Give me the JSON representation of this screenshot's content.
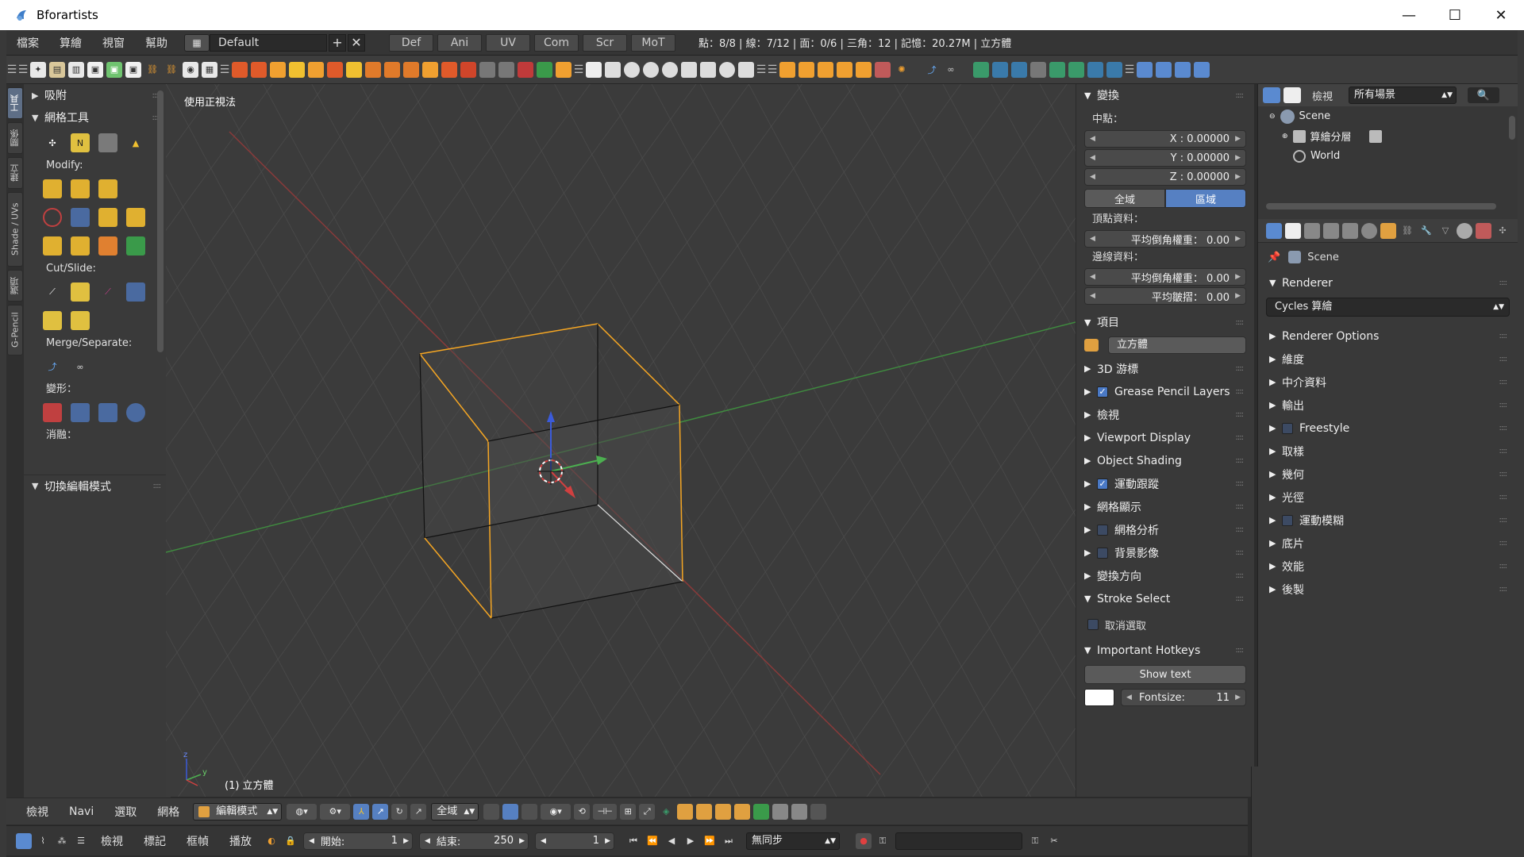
{
  "window": {
    "title": "Bforartists",
    "controls": [
      "—",
      "☐",
      "✕"
    ]
  },
  "menubar": {
    "items": [
      "檔案",
      "算繪",
      "視窗",
      "幫助"
    ],
    "screen_name": "Default",
    "add_label": "+",
    "remove_label": "✕",
    "workspace_tabs": [
      "Def",
      "Ani",
      "UV",
      "Com",
      "Scr",
      "MoT"
    ],
    "stats": "點：8/8 | 線：7/12 | 面：0/6 | 三角：12 | 記憶：20.27M | 立方體"
  },
  "vertical_tabs": [
    "工具",
    "關係",
    "建立",
    "Shade / UVs",
    "選項",
    "G-Pencil"
  ],
  "toolshelf": {
    "panel_snap": "吸附",
    "panel_mesh_tools": "網格工具",
    "section_modify": "Modify:",
    "section_cutslide": "Cut/Slide:",
    "section_merge": "Merge/Separate:",
    "section_deform": "變形：",
    "section_dissolve": "消融：",
    "panel_toggle_edit": "切換編輯模式"
  },
  "viewport": {
    "view_label": "使用正視法",
    "object_label": "(1) 立方體"
  },
  "npanel": {
    "transform_title": "變換",
    "median_label": "中點：",
    "x_value": "X :  0.00000",
    "y_value": "Y :  0.00000",
    "z_value": "Z :  0.00000",
    "global_label": "全域",
    "local_label": "區域",
    "vertex_data_label": "頂點資料：",
    "vertex_bevel": "平均倒角權重：  0.00",
    "edge_data_label": "邊線資料：",
    "edge_bevel": "平均倒角權重：  0.00",
    "edge_crease": "平均皺摺：  0.00",
    "item_title": "項目",
    "item_name": "立方體",
    "rows": [
      {
        "label": "3D 游標",
        "checkbox": false
      },
      {
        "label": "Grease Pencil Layers",
        "checkbox": true,
        "checked": true
      },
      {
        "label": "檢視",
        "checkbox": false
      },
      {
        "label": "Viewport Display",
        "checkbox": false
      },
      {
        "label": "Object Shading",
        "checkbox": false
      },
      {
        "label": "運動跟蹤",
        "checkbox": true,
        "checked": true
      },
      {
        "label": "網格顯示",
        "checkbox": false
      },
      {
        "label": "網格分析",
        "checkbox": true,
        "checked": false
      },
      {
        "label": "背景影像",
        "checkbox": true,
        "checked": false
      },
      {
        "label": "變換方向",
        "checkbox": false
      }
    ],
    "stroke_select_title": "Stroke Select",
    "deselect_label": "取消選取",
    "hotkeys_title": "Important Hotkeys",
    "show_text_label": "Show text",
    "fontsize_label": "Fontsize:",
    "fontsize_value": "11"
  },
  "outliner": {
    "view_label": "檢視",
    "filter_value": "所有場景",
    "tree": [
      "Scene",
      "算繪分層",
      "World"
    ]
  },
  "properties": {
    "context_label": "Scene",
    "renderer_title": "Renderer",
    "renderer_value": "Cycles 算繪",
    "sections": [
      {
        "label": "Renderer Options",
        "checkbox": false
      },
      {
        "label": "維度",
        "checkbox": false
      },
      {
        "label": "中介資料",
        "checkbox": false
      },
      {
        "label": "輸出",
        "checkbox": false
      },
      {
        "label": "Freestyle",
        "checkbox": true
      },
      {
        "label": "取樣",
        "checkbox": false
      },
      {
        "label": "幾何",
        "checkbox": false
      },
      {
        "label": "光徑",
        "checkbox": false
      },
      {
        "label": "運動模糊",
        "checkbox": true
      },
      {
        "label": "底片",
        "checkbox": false
      },
      {
        "label": "效能",
        "checkbox": false
      },
      {
        "label": "後製",
        "checkbox": false
      }
    ]
  },
  "viewport_header": {
    "menus": [
      "檢視",
      "Navi",
      "選取",
      "網格"
    ],
    "mode": "編輯模式",
    "orientation": "全域"
  },
  "timeline": {
    "menus": [
      "檢視",
      "標記",
      "框幀",
      "播放"
    ],
    "start_label": "開始:",
    "start_value": "1",
    "end_label": "結束:",
    "end_value": "250",
    "current_frame": "1",
    "sync_value": "無同步"
  },
  "colors": {
    "accent_blue": "#5680c2",
    "edge_select": "#f5a623",
    "axis_x": "#d04040",
    "axis_y": "#4caf50",
    "axis_z": "#3b5bdb"
  }
}
